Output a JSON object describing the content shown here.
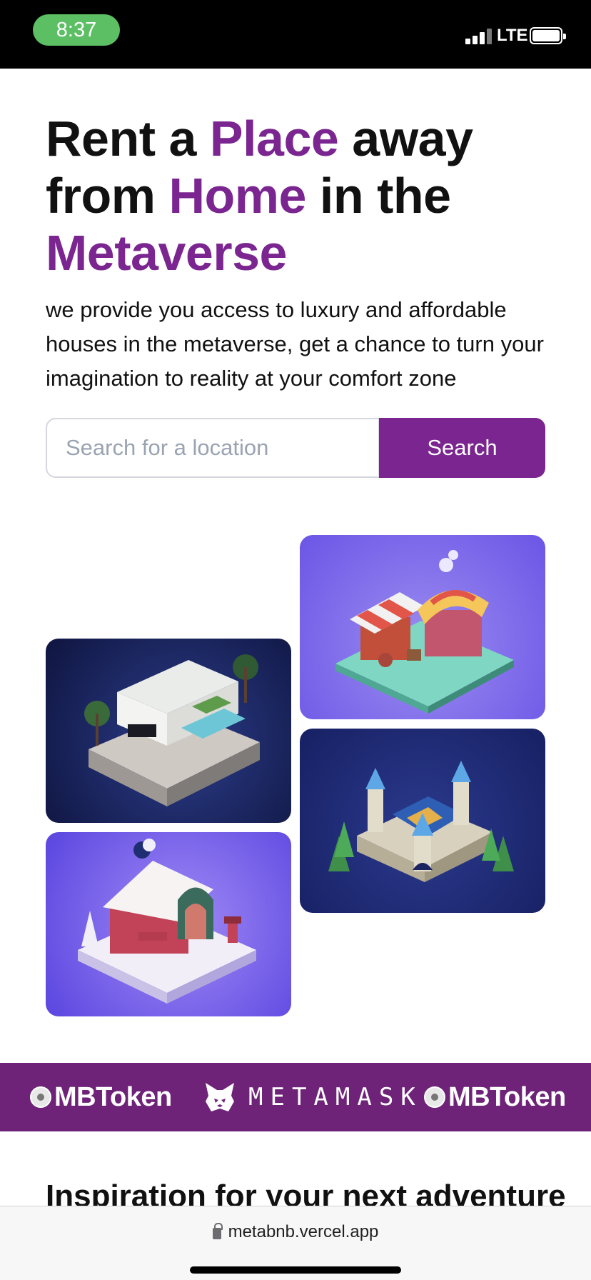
{
  "status_bar": {
    "time": "8:37",
    "network": "LTE"
  },
  "hero": {
    "title": {
      "w1": "Rent a ",
      "w2": "Place",
      "w3": " away",
      "w4": "from ",
      "w5": "Home",
      "w6": " in the",
      "w7": "Metaverse"
    },
    "subtitle": "we provide you access to luxury and affordable houses in the metaverse, get a chance to turn your imagination to reality at your comfort zone",
    "accent_color": "#7b2590"
  },
  "search": {
    "placeholder": "Search for a location",
    "button_label": "Search"
  },
  "gallery": [
    {
      "name": "market-stall-tile"
    },
    {
      "name": "modern-villa-tile"
    },
    {
      "name": "castle-tile"
    },
    {
      "name": "winter-cottage-tile"
    }
  ],
  "partners": [
    {
      "label": "MBToken",
      "icon": "mbtoken-coin-icon"
    },
    {
      "label": "METAMASK",
      "icon": "metamask-fox-icon"
    },
    {
      "label": "MBToken",
      "icon": "mbtoken-coin-icon"
    }
  ],
  "section": {
    "title": "Inspiration for your next adventure"
  },
  "browser": {
    "url": "metabnb.vercel.app"
  }
}
